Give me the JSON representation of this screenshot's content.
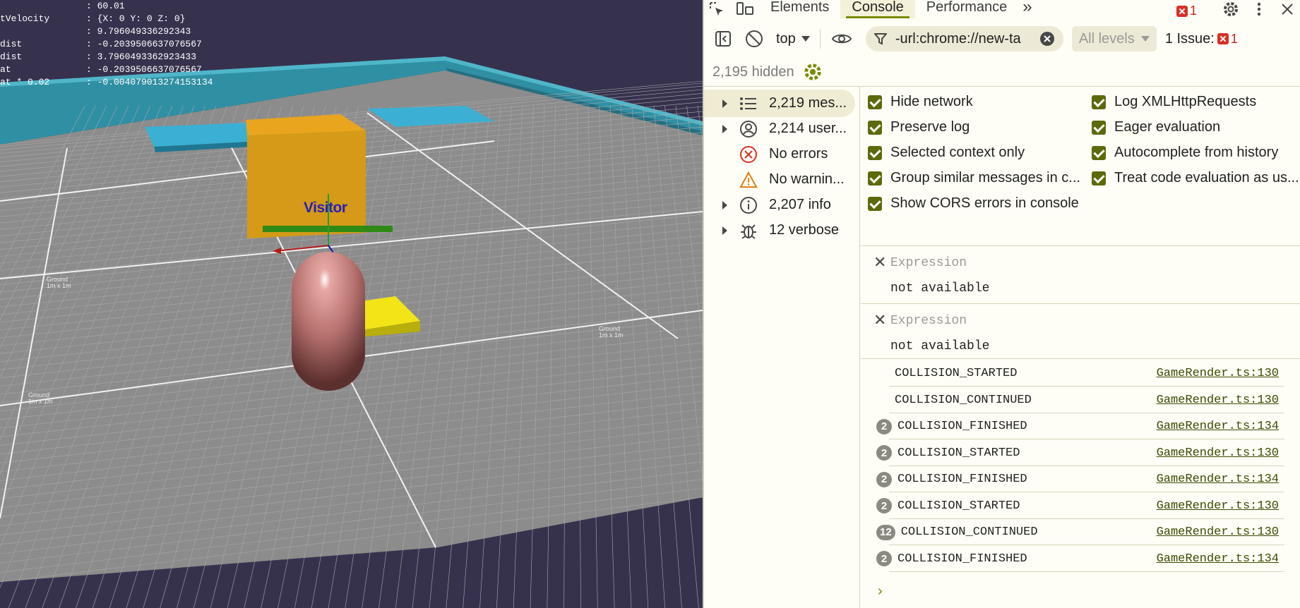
{
  "debug_panel": {
    "rows": [
      {
        "key": "",
        "value": ": 60.01"
      },
      {
        "key": "tVelocity",
        "value": ": {X: 0 Y: 0 Z: 0}"
      },
      {
        "key": "",
        "value": ": 9.796049336292343"
      },
      {
        "key": "dist",
        "value": ": -0.2039506637076567"
      },
      {
        "key": "dist",
        "value": ": 3.7960493362923433"
      },
      {
        "key": "at",
        "value": ": -0.2039506637076567"
      },
      {
        "key": "at * 0.02",
        "value": ": -0.004079013274153134"
      }
    ]
  },
  "scene": {
    "visitor_label": "Visitor",
    "ground_tag_title": "Ground",
    "ground_tag_size": "1m x 1m",
    "colors": {
      "background": "#36324e",
      "floor": "#8c8c8c",
      "wall": "#2f8fa3",
      "box": "#d49a18",
      "platform": "#3bb0d4",
      "capsule": "#c07b78",
      "yellow_block": "#f2e416"
    }
  },
  "devtools": {
    "tabs": [
      {
        "label": "Elements",
        "active": false
      },
      {
        "label": "Console",
        "active": true
      },
      {
        "label": "Performance",
        "active": false
      }
    ],
    "more_tabs": "»",
    "error_count": "1",
    "toolbar": {
      "context": "top",
      "filter_text": "-url:chrome://new-ta",
      "levels": "All levels",
      "issues_label": "1 Issue:",
      "issues_count": "1"
    },
    "hidden_count": "2,195 hidden",
    "sidebar": [
      {
        "label": "2,219 mes...",
        "icon": "list-icon",
        "expandable": true,
        "selected": true
      },
      {
        "label": "2,214 user...",
        "icon": "user-icon",
        "expandable": true,
        "selected": false
      },
      {
        "label": "No errors",
        "icon": "error-icon",
        "expandable": false,
        "selected": false
      },
      {
        "label": "No warnin...",
        "icon": "warning-icon",
        "expandable": false,
        "selected": false
      },
      {
        "label": "2,207 info",
        "icon": "info-icon",
        "expandable": true,
        "selected": false
      },
      {
        "label": "12 verbose",
        "icon": "bug-icon",
        "expandable": true,
        "selected": false
      }
    ],
    "settings": {
      "left": [
        "Hide network",
        "Preserve log",
        "Selected context only",
        "Group similar messages in c...",
        "Show CORS errors in console"
      ],
      "right": [
        "Log XMLHttpRequests",
        "Eager evaluation",
        "Autocomplete from history",
        "Treat code evaluation as us..."
      ]
    },
    "expressions": [
      {
        "placeholder": "Expression",
        "value": "not available"
      },
      {
        "placeholder": "Expression",
        "value": "not available"
      }
    ],
    "logs": [
      {
        "count": "",
        "message": "COLLISION_STARTED",
        "source": "GameRender.ts:130"
      },
      {
        "count": "",
        "message": "COLLISION_CONTINUED",
        "source": "GameRender.ts:130"
      },
      {
        "count": "2",
        "message": "COLLISION_FINISHED",
        "source": "GameRender.ts:134"
      },
      {
        "count": "2",
        "message": "COLLISION_STARTED",
        "source": "GameRender.ts:130"
      },
      {
        "count": "2",
        "message": "COLLISION_FINISHED",
        "source": "GameRender.ts:134"
      },
      {
        "count": "2",
        "message": "COLLISION_STARTED",
        "source": "GameRender.ts:130"
      },
      {
        "count": "12",
        "message": "COLLISION_CONTINUED",
        "source": "GameRender.ts:130"
      },
      {
        "count": "2",
        "message": "COLLISION_FINISHED",
        "source": "GameRender.ts:134"
      }
    ],
    "prompt": "›"
  }
}
